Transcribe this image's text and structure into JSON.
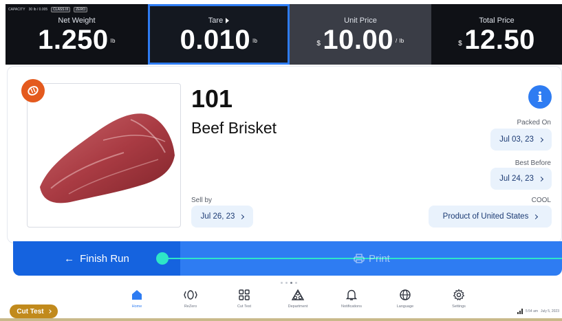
{
  "status_bar": {
    "items": [
      "CAPACITY",
      "30 lb / 0.005",
      "CLASS III",
      "ZERO"
    ]
  },
  "weight_bar": {
    "net_weight": {
      "label": "Net Weight",
      "value": "1.250",
      "unit": "lb"
    },
    "tare": {
      "label": "Tare",
      "value": "0.010",
      "unit": "lb"
    },
    "unit_price": {
      "label": "Unit Price",
      "currency": "$",
      "value": "10.00",
      "unit": "/ lb"
    },
    "total_price": {
      "label": "Total Price",
      "currency": "$",
      "value": "12.50"
    }
  },
  "product": {
    "code": "101",
    "name": "Beef Brisket",
    "icon": "meat-badge-icon",
    "packed_on": {
      "label": "Packed On",
      "value": "Jul 03, 23"
    },
    "best_before": {
      "label": "Best Before",
      "value": "Jul 24, 23"
    },
    "sell_by": {
      "label": "Sell by",
      "value": "Jul 26, 23"
    },
    "cool": {
      "label": "COOL",
      "value": "Product of United States"
    }
  },
  "actions": {
    "finish_run": "Finish Run",
    "print": "Print",
    "slider_progress": 0.0
  },
  "nav": {
    "items": [
      {
        "label": "Home",
        "icon": "home-icon"
      },
      {
        "label": "ReZero",
        "icon": "zero-icon"
      },
      {
        "label": "Cut Test",
        "icon": "grid-icon"
      },
      {
        "label": "Department",
        "icon": "department-icon"
      },
      {
        "label": "Notifications",
        "icon": "bell-icon"
      },
      {
        "label": "Language",
        "icon": "globe-icon"
      },
      {
        "label": "Settings",
        "icon": "gear-icon"
      }
    ],
    "active": "Home"
  },
  "cut_test_button": "Cut Test",
  "system": {
    "clock": "5:54 am",
    "date": "July 5, 2023"
  },
  "colors": {
    "accent": "#2e7cf2",
    "accent_dark": "#1563df",
    "slider": "#2ee6c7",
    "badge": "#e45a1e",
    "cut_test": "#c18a1c",
    "top_bar": "#0f1116"
  }
}
